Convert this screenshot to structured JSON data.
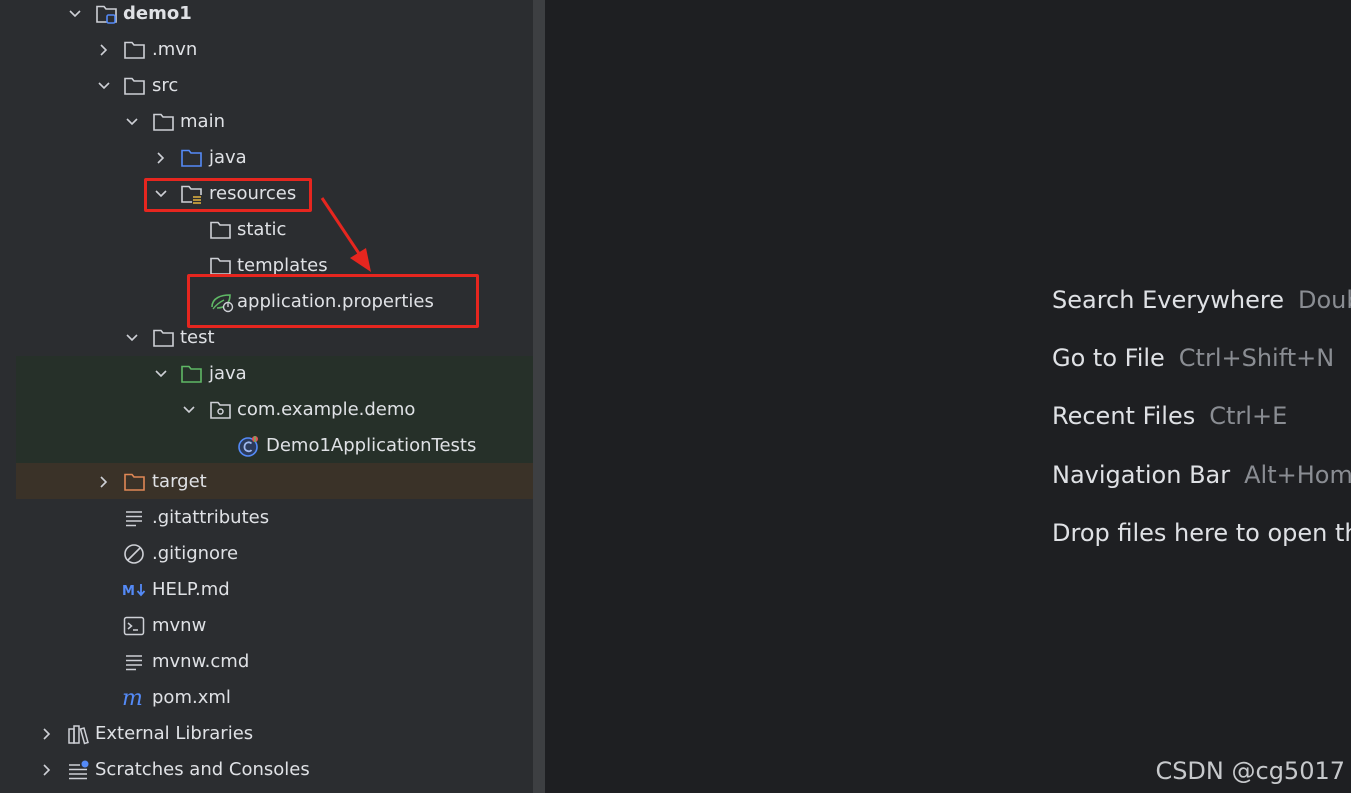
{
  "project_tree": {
    "items": [
      {
        "label": "demo1",
        "icon": "module-folder-icon"
      },
      {
        "label": ".mvn",
        "icon": "folder-icon"
      },
      {
        "label": "src",
        "icon": "folder-icon"
      },
      {
        "label": "main",
        "icon": "folder-icon"
      },
      {
        "label": "java",
        "icon": "source-folder-icon"
      },
      {
        "label": "resources",
        "icon": "resources-folder-icon"
      },
      {
        "label": "static",
        "icon": "folder-icon"
      },
      {
        "label": "templates",
        "icon": "folder-icon"
      },
      {
        "label": "application.properties",
        "icon": "spring-properties-icon"
      },
      {
        "label": "test",
        "icon": "folder-icon"
      },
      {
        "label": "java",
        "icon": "test-source-folder-icon"
      },
      {
        "label": "com.example.demo",
        "icon": "package-icon"
      },
      {
        "label": "Demo1ApplicationTests",
        "icon": "test-class-icon"
      },
      {
        "label": "target",
        "icon": "excluded-folder-icon"
      },
      {
        "label": ".gitattributes",
        "icon": "text-file-icon"
      },
      {
        "label": ".gitignore",
        "icon": "ignore-file-icon"
      },
      {
        "label": "HELP.md",
        "icon": "markdown-icon"
      },
      {
        "label": "mvnw",
        "icon": "shell-script-icon"
      },
      {
        "label": "mvnw.cmd",
        "icon": "text-file-icon"
      },
      {
        "label": "pom.xml",
        "icon": "maven-icon"
      },
      {
        "label": "External Libraries",
        "icon": "libraries-icon"
      },
      {
        "label": "Scratches and Consoles",
        "icon": "scratches-icon"
      }
    ]
  },
  "editor": {
    "hints": [
      {
        "action": "Search Everywhere",
        "shortcut": "Double Shift"
      },
      {
        "action": "Go to File",
        "shortcut": "Ctrl+Shift+N"
      },
      {
        "action": "Recent Files",
        "shortcut": "Ctrl+E"
      },
      {
        "action": "Navigation Bar",
        "shortcut": "Alt+Home"
      },
      {
        "action": "Drop files here to open them",
        "shortcut": ""
      }
    ]
  },
  "watermark": "CSDN @cg5017",
  "colors": {
    "highlight_border": "#e6261f",
    "test_band": "#263029",
    "excluded_band": "#3a3228",
    "source_folder": "#548af7",
    "test_folder": "#5fb865",
    "excluded_folder": "#e08855"
  }
}
